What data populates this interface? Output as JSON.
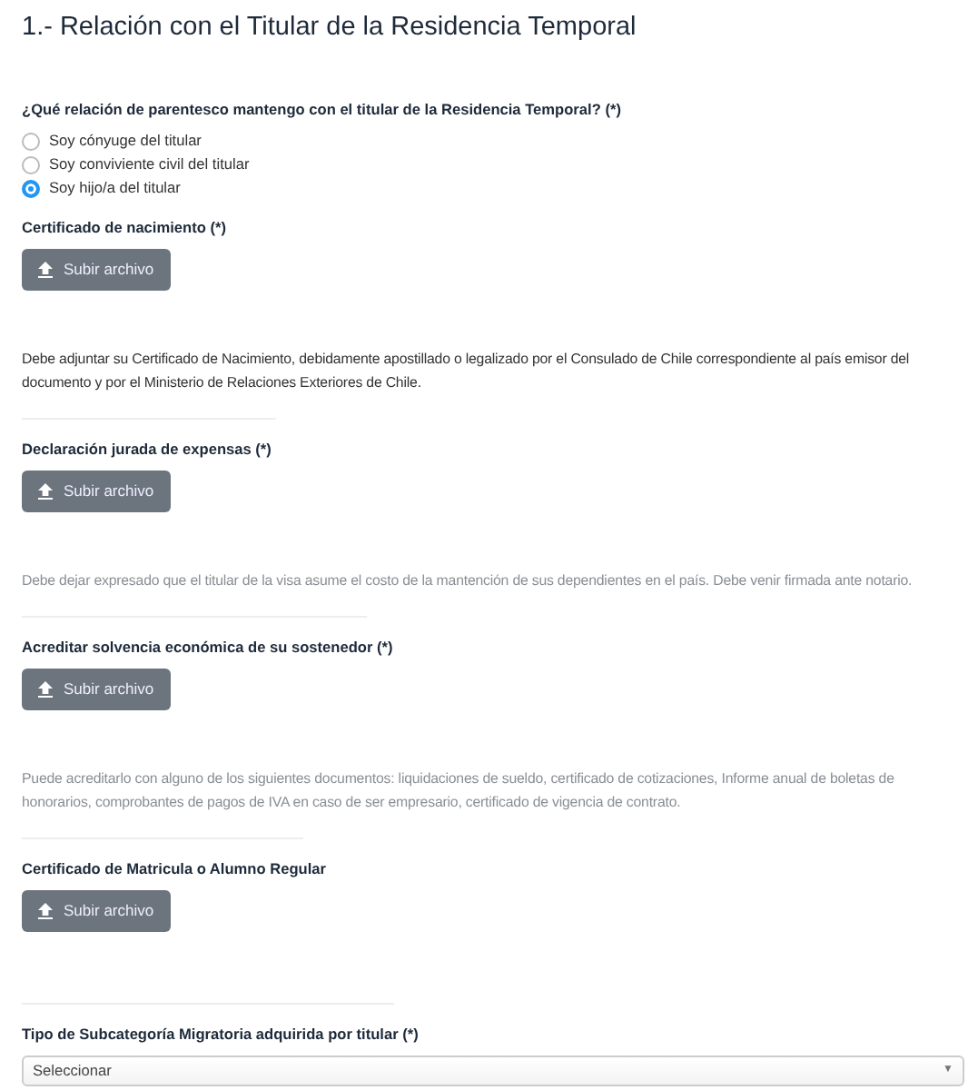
{
  "title": "1.- Relación con el Titular de la Residencia Temporal",
  "question": {
    "label": "¿Qué relación de parentesco mantengo con el titular de la Residencia Temporal? (*)",
    "options": [
      {
        "label": "Soy cónyuge del titular",
        "selected": false
      },
      {
        "label": "Soy conviviente civil del titular",
        "selected": false
      },
      {
        "label": "Soy hijo/a del titular",
        "selected": true
      }
    ]
  },
  "uploads": [
    {
      "label": "Certificado de nacimiento (*)",
      "button": "Subir archivo",
      "description": "Debe adjuntar su Certificado de Nacimiento, debidamente apostillado o legalizado por el Consulado de Chile correspondiente al país emisor del documento y por el Ministerio de Relaciones Exteriores de Chile.",
      "muted": false
    },
    {
      "label": "Declaración jurada de expensas (*)",
      "button": "Subir archivo",
      "description": "Debe dejar expresado que el titular de la visa asume el costo de la mantención de sus dependientes en el país. Debe venir firmada ante notario.",
      "muted": true
    },
    {
      "label": "Acreditar solvencia económica de su sostenedor (*)",
      "button": "Subir archivo",
      "description": "Puede acreditarlo con alguno de los siguientes documentos: liquidaciones de sueldo, certificado de cotizaciones, Informe anual de boletas de honorarios, comprobantes de pagos de IVA en caso de ser empresario, certificado de vigencia de contrato.",
      "muted": true
    },
    {
      "label": "Certificado de Matricula o Alumno Regular",
      "button": "Subir archivo"
    }
  ],
  "select": {
    "label": "Tipo de Subcategoría Migratoria adquirida por titular (*)",
    "value": "Seleccionar",
    "arrow": "▼"
  }
}
